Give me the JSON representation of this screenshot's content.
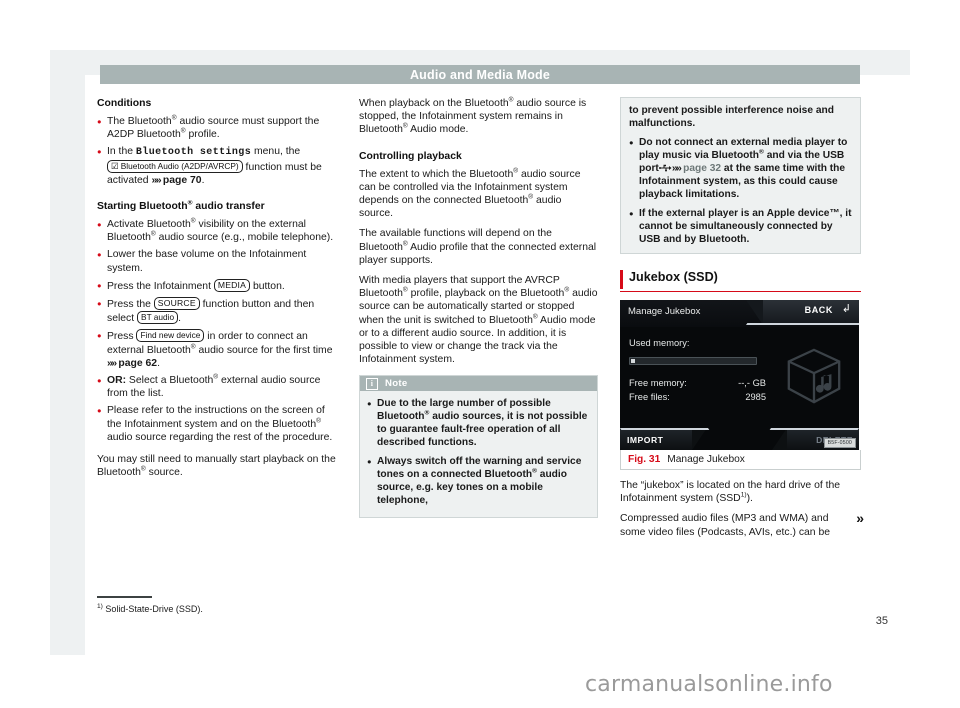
{
  "header": {
    "title": "Audio and Media Mode"
  },
  "left_column": {
    "heading_conditions": "Conditions",
    "bullet1_a": "The Bluetooth",
    "bullet1_b": " audio source must support the A2DP Bluetooth",
    "bullet1_c": " profile.",
    "bullet2_a": "In the ",
    "bullet2_menu": "Bluetooth settings",
    "bullet2_b": " menu, the ",
    "bullet2_button": "Bluetooth Audio (A2DP/AVRCP)",
    "bullet2_c": " function must be activated ",
    "bullet2_ref": "page 70",
    "bullet2_d": ".",
    "heading_starting": "Starting Bluetooth",
    "heading_starting_tail": " audio transfer",
    "bullet3_a": "Activate Bluetooth",
    "bullet3_b": " visibility on the external Bluetooth",
    "bullet3_c": " audio source (e.g., mobile telephone).",
    "bullet4": "Lower the base volume on the Infotainment system.",
    "bullet5_a": "Press the Infotainment ",
    "bullet5_key": "MEDIA",
    "bullet5_b": " button.",
    "bullet6_a": "Press the ",
    "bullet6_key1": "SOURCE",
    "bullet6_b": " function button and then select ",
    "bullet6_key2": "BT audio",
    "bullet6_c": ".",
    "bullet7_a": "Press ",
    "bullet7_key": "Find new device",
    "bullet7_b": " in order to connect an external Bluetooth",
    "bullet7_c": " audio source for the first time ",
    "bullet7_ref": "page 62",
    "bullet7_d": ".",
    "bullet8_prefix": "OR:",
    "bullet8_a": " Select a Bluetooth",
    "bullet8_b": " external audio source from the list.",
    "bullet9_a": "Please refer to the instructions on the screen of the Infotainment system and on the Bluetooth",
    "bullet9_b": " audio source regarding the rest of the procedure.",
    "para_manual_a": "You may still need to manually start playback on the Bluetooth",
    "para_manual_b": " source."
  },
  "middle_column": {
    "para1_a": "When playback on the Bluetooth",
    "para1_b": " audio source is stopped, the Infotainment system remains in Bluetooth",
    "para1_c": " Audio mode.",
    "heading_controlling": "Controlling playback",
    "para2_a": "The extent to which the Bluetooth",
    "para2_b": " audio source can be controlled via the Infotainment system depends on the connected Bluetooth",
    "para2_c": " audio source.",
    "para3_a": "The available functions will depend on the Bluetooth",
    "para3_b": " Audio profile that the connected external player supports.",
    "para4_a": "With media players that support the AVRCP Bluetooth",
    "para4_b": " profile, playback on the Bluetooth",
    "para4_c": " audio source can be automatically started or stopped when the unit is switched to Bluetooth",
    "para4_d": " Audio mode or to a different audio source. In addition, it is possible to view or change the track via the Infotainment system.",
    "note": {
      "title": "Note",
      "icon": "info-icon",
      "bullet1_a": "Due to the large number of possible Bluetooth",
      "bullet1_b": " audio sources, it is not possible to guarantee fault-free operation of all described functions.",
      "bullet2_a": "Always switch off the warning and service tones on a connected Bluetooth",
      "bullet2_b": " audio source, e.g. key tones on a mobile telephone,"
    }
  },
  "right_column": {
    "warning": {
      "para_continued": "to prevent possible interference noise and malfunctions.",
      "bullet1_a": "Do not connect an external media player to play music via Bluetooth",
      "bullet1_b": " and via the USB port",
      "bullet1_icon": "usb-port-icon",
      "bullet1_ref": "page 32",
      "bullet1_c": " at the same time with the Infotainment system, as this could cause playback limitations.",
      "bullet2": "If the external player is an Apple device™, it cannot be simultaneously connected by USB and by Bluetooth."
    },
    "section_title": "Jukebox (SSD)",
    "figure": {
      "screen_title": "Manage Jukebox",
      "back_label": "BACK",
      "back_icon": "back-arrow-icon",
      "used_memory_label": "Used memory:",
      "free_memory_label": "Free memory:",
      "free_memory_value": "--,- GB",
      "free_files_label": "Free files:",
      "free_files_value": "2985",
      "import_label": "IMPORT",
      "delete_label": "DELETE",
      "cube_icon": "music-cube-icon",
      "watermark": "B5F-0500",
      "caption_number": "Fig. 31",
      "caption_text": "Manage Jukebox"
    },
    "para1_a": "The “jukebox” is located on the hard drive of the Infotainment system (SSD",
    "para1_sup": "1)",
    "para1_b": ").",
    "para2": "Compressed audio files (MP3 and WMA) and some video files (Podcasts, AVIs, etc.) can be",
    "continue_arrow": "»"
  },
  "footnote": {
    "marker": "1)",
    "text": "Solid-State-Drive (SSD)."
  },
  "page_number": "35",
  "site_watermark": "carmanualsonline.info",
  "colors": {
    "accent_red": "#d60a18",
    "header_gray": "#a8b4b4",
    "panel_bg": "#eef1f2",
    "note_bg": "#eef1f1"
  }
}
